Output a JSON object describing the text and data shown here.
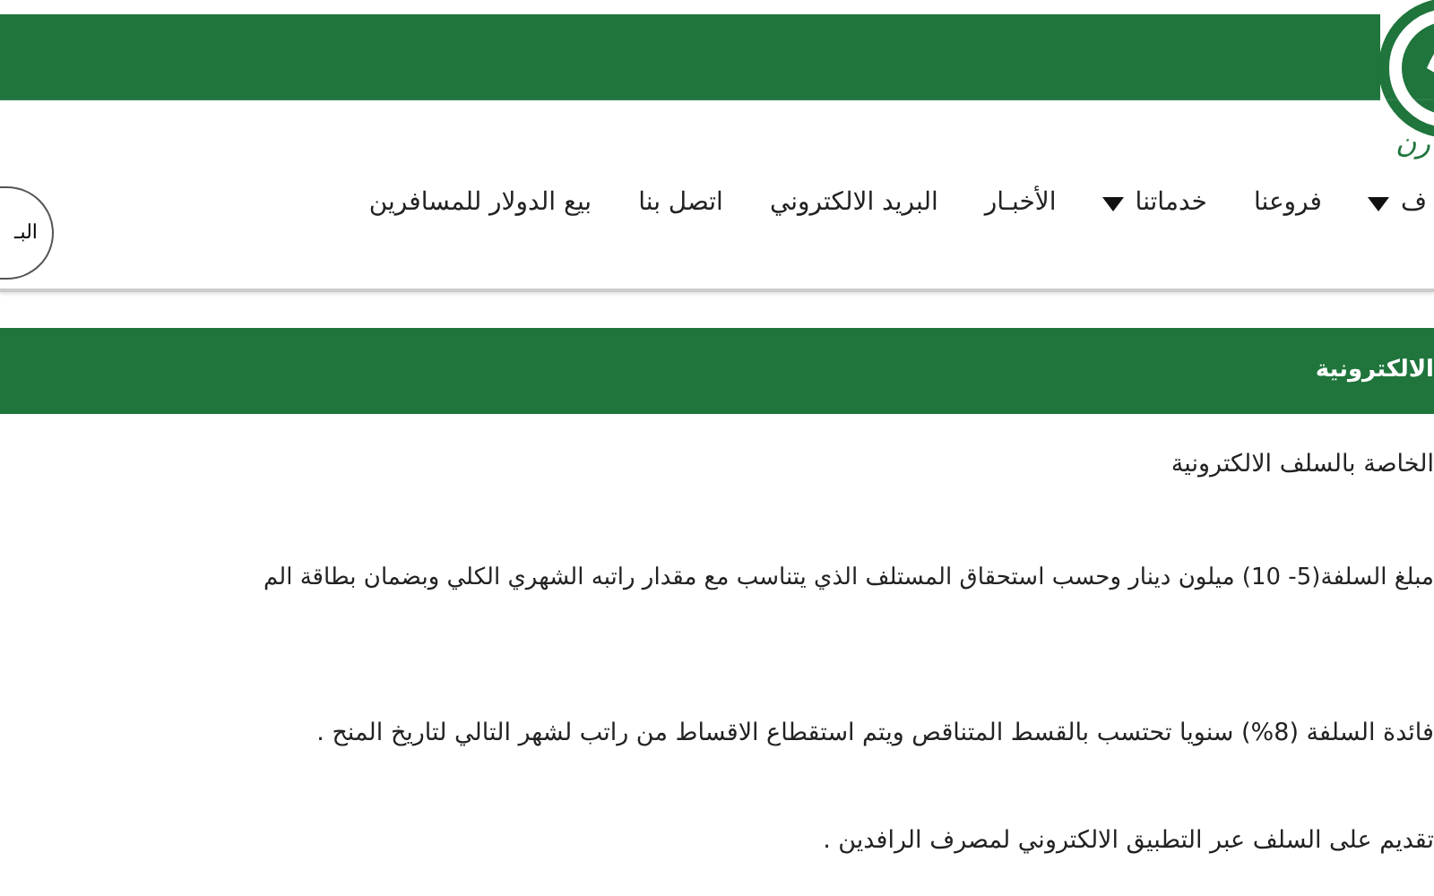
{
  "header": {
    "logo_text": "رن"
  },
  "nav": {
    "items": [
      {
        "label": "ف",
        "dropdown": true
      },
      {
        "label": "فروعنا",
        "dropdown": false
      },
      {
        "label": "خدماتنا",
        "dropdown": true
      },
      {
        "label": "الأخبـار",
        "dropdown": false
      },
      {
        "label": "البريد الالكتروني",
        "dropdown": false
      },
      {
        "label": "اتصل بنا",
        "dropdown": false
      },
      {
        "label": "بيع الدولار للمسافرين",
        "dropdown": false
      }
    ],
    "round_button": "البـ"
  },
  "section": {
    "title": "الالكترونية",
    "paragraphs": [
      "الخاصة بالسلف الالكترونية",
      "مبلغ السلفة(5- 10) ميلون دينار وحسب استحقاق المستلف الذي يتناسب مع مقدار راتبه الشهري الكلي وبضمان بطاقة الم",
      "فائدة السلفة (8%) سنويا تحتسب بالقسط المتناقص ويتم استقطاع الاقساط من راتب لشهر التالي لتاريخ المنح .",
      "تقديم على السلف عبر التطبيق الالكتروني لمصرف الرافدين ."
    ]
  }
}
